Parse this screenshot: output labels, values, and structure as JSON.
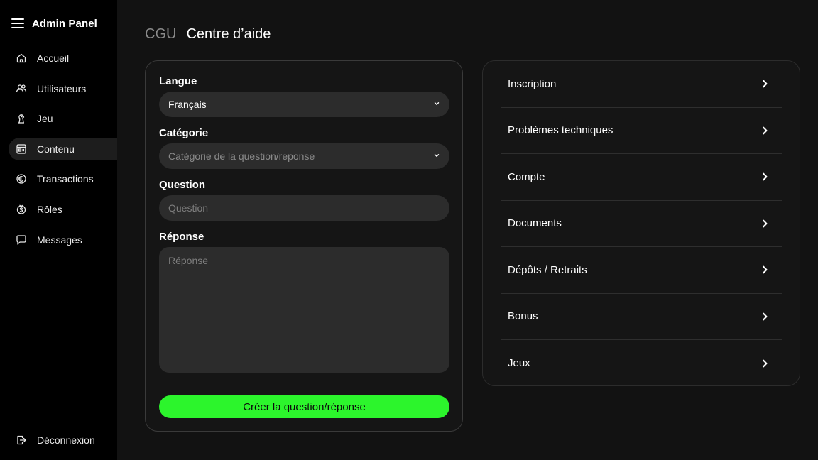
{
  "app": {
    "title": "Admin Panel"
  },
  "sidebar": {
    "items": [
      {
        "label": "Accueil",
        "icon": "home-icon",
        "active": false
      },
      {
        "label": "Utilisateurs",
        "icon": "users-icon",
        "active": false
      },
      {
        "label": "Jeu",
        "icon": "game-icon",
        "active": false
      },
      {
        "label": "Contenu",
        "icon": "content-icon",
        "active": true
      },
      {
        "label": "Transactions",
        "icon": "transactions-icon",
        "active": false
      },
      {
        "label": "Rôles",
        "icon": "roles-icon",
        "active": false
      },
      {
        "label": "Messages",
        "icon": "message-icon",
        "active": false
      }
    ],
    "logout": {
      "label": "Déconnexion",
      "icon": "logout-icon"
    }
  },
  "header": {
    "breadcrumb": "CGU",
    "title": "Centre d’aide"
  },
  "form": {
    "language": {
      "label": "Langue",
      "value": "Français"
    },
    "category": {
      "label": "Catégorie",
      "placeholder": "Catégorie de la question/reponse"
    },
    "question": {
      "label": "Question",
      "placeholder": "Question"
    },
    "answer": {
      "label": "Réponse",
      "placeholder": "Réponse"
    },
    "submit_label": "Créer la question/réponse"
  },
  "categories": [
    "Inscription",
    "Problèmes techniques",
    "Compte",
    "Documents",
    "Dépôts / Retraits",
    "Bonus",
    "Jeux"
  ],
  "colors": {
    "background": "#121212",
    "sidebar": "#000000",
    "accent": "#2cf52c",
    "field": "#2c2c2c"
  }
}
